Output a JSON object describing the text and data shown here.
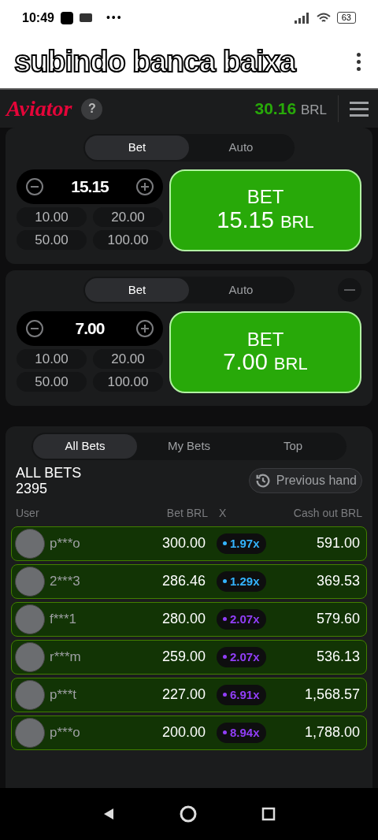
{
  "status_bar": {
    "time": "10:49",
    "battery": "63",
    "more": "•••"
  },
  "caption": "subindo banca baixa",
  "header": {
    "logo": "Aviator",
    "help": "?",
    "balance": "30.16",
    "currency": "BRL"
  },
  "bet_panels": [
    {
      "tabs": [
        {
          "label": "Bet",
          "selected": true
        },
        {
          "label": "Auto",
          "selected": false
        }
      ],
      "removable": false,
      "amount": "15.15",
      "presets": [
        "10.00",
        "20.00",
        "50.00",
        "100.00"
      ],
      "button": {
        "label": "BET",
        "amount": "15.15",
        "currency": "BRL"
      }
    },
    {
      "tabs": [
        {
          "label": "Bet",
          "selected": true
        },
        {
          "label": "Auto",
          "selected": false
        }
      ],
      "removable": true,
      "amount": "7.00",
      "presets": [
        "10.00",
        "20.00",
        "50.00",
        "100.00"
      ],
      "button": {
        "label": "BET",
        "amount": "7.00",
        "currency": "BRL"
      }
    }
  ],
  "bets": {
    "tabs": [
      {
        "label": "All Bets",
        "selected": true
      },
      {
        "label": "My Bets",
        "selected": false
      },
      {
        "label": "Top",
        "selected": false
      }
    ],
    "title": "ALL BETS",
    "count": "2395",
    "previous_hand": "Previous hand",
    "columns": [
      "User",
      "Bet BRL",
      "X",
      "Cash out BRL"
    ],
    "rows": [
      {
        "user": "p***o",
        "bet": "300.00",
        "multiplier": "1.97x",
        "color": "#34b4ff",
        "cashout": "591.00"
      },
      {
        "user": "2***3",
        "bet": "286.46",
        "multiplier": "1.29x",
        "color": "#34b4ff",
        "cashout": "369.53"
      },
      {
        "user": "f***1",
        "bet": "280.00",
        "multiplier": "2.07x",
        "color": "#913ef8",
        "cashout": "579.60"
      },
      {
        "user": "r***m",
        "bet": "259.00",
        "multiplier": "2.07x",
        "color": "#913ef8",
        "cashout": "536.13"
      },
      {
        "user": "p***t",
        "bet": "227.00",
        "multiplier": "6.91x",
        "color": "#913ef8",
        "cashout": "1,568.57"
      },
      {
        "user": "p***o",
        "bet": "200.00",
        "multiplier": "8.94x",
        "color": "#913ef8",
        "cashout": "1,788.00"
      }
    ]
  }
}
